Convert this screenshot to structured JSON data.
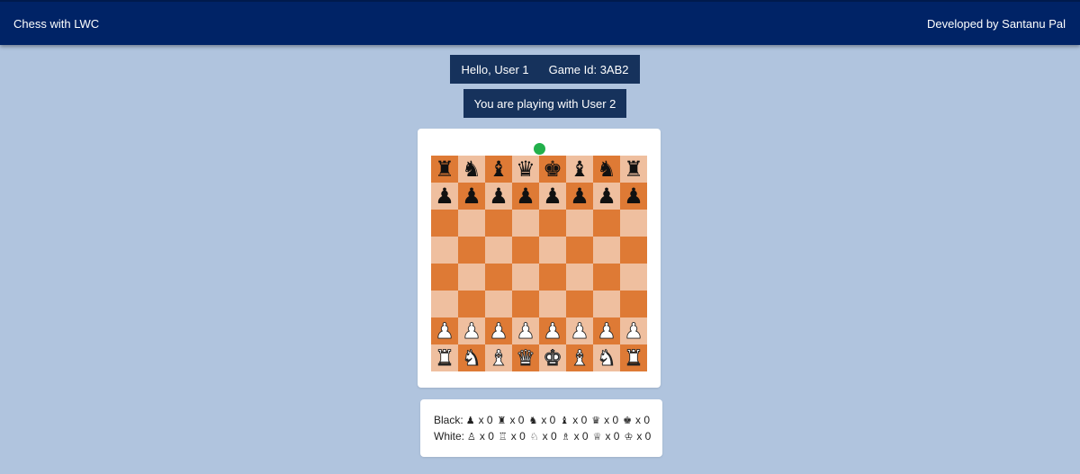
{
  "header": {
    "title": "Chess with LWC",
    "credit": "Developed by Santanu Pal"
  },
  "session": {
    "greeting": "Hello, User 1",
    "game_id": "Game Id: 3AB2",
    "opponent": "You are playing with User 2"
  },
  "turn_indicator": {
    "color": "#22b04b"
  },
  "colors": {
    "page_bg": "#b0c4de",
    "navbar_bg": "#002366",
    "info_bg": "#16325c",
    "square_light": "#efbf9f",
    "square_dark": "#de7a35"
  },
  "board": {
    "ranks": [
      [
        "r",
        "n",
        "b",
        "q",
        "k",
        "b",
        "n",
        "r"
      ],
      [
        "p",
        "p",
        "p",
        "p",
        "p",
        "p",
        "p",
        "p"
      ],
      [
        "",
        "",
        "",
        "",
        "",
        "",
        "",
        ""
      ],
      [
        "",
        "",
        "",
        "",
        "",
        "",
        "",
        ""
      ],
      [
        "",
        "",
        "",
        "",
        "",
        "",
        "",
        ""
      ],
      [
        "",
        "",
        "",
        "",
        "",
        "",
        "",
        ""
      ],
      [
        "P",
        "P",
        "P",
        "P",
        "P",
        "P",
        "P",
        "P"
      ],
      [
        "R",
        "N",
        "B",
        "Q",
        "K",
        "B",
        "N",
        "R"
      ]
    ]
  },
  "captured": {
    "black": {
      "label": "Black:",
      "items": [
        {
          "icon": "black-pawn-icon",
          "glyph": "♟",
          "count": "x 0"
        },
        {
          "icon": "black-rook-icon",
          "glyph": "♜",
          "count": "x 0"
        },
        {
          "icon": "black-knight-icon",
          "glyph": "♞",
          "count": "x 0"
        },
        {
          "icon": "black-bishop-icon",
          "glyph": "♝",
          "count": "x 0"
        },
        {
          "icon": "black-queen-icon",
          "glyph": "♛",
          "count": "x 0"
        },
        {
          "icon": "black-king-icon",
          "glyph": "♚",
          "count": "x 0"
        }
      ]
    },
    "white": {
      "label": "White:",
      "items": [
        {
          "icon": "white-pawn-icon",
          "glyph": "♙",
          "count": "x 0"
        },
        {
          "icon": "white-rook-icon",
          "glyph": "♖",
          "count": "x 0"
        },
        {
          "icon": "white-knight-icon",
          "glyph": "♘",
          "count": "x 0"
        },
        {
          "icon": "white-bishop-icon",
          "glyph": "♗",
          "count": "x 0"
        },
        {
          "icon": "white-queen-icon",
          "glyph": "♕",
          "count": "x 0"
        },
        {
          "icon": "white-king-icon",
          "glyph": "♔",
          "count": "x 0"
        }
      ]
    }
  }
}
